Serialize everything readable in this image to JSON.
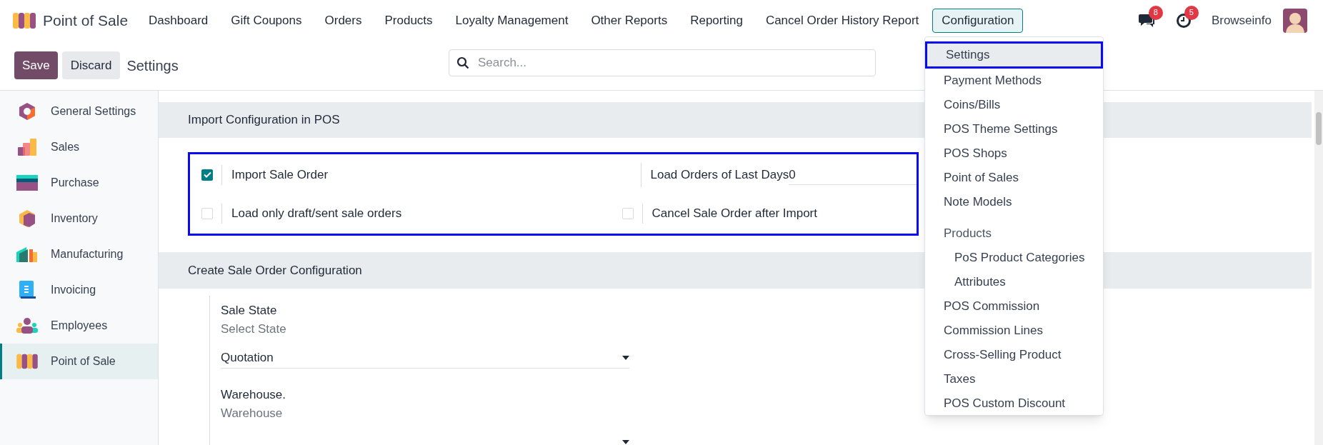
{
  "app": {
    "name": "Point of Sale"
  },
  "nav": [
    {
      "label": "Dashboard",
      "selected": false
    },
    {
      "label": "Gift Coupons",
      "selected": false
    },
    {
      "label": "Orders",
      "selected": false
    },
    {
      "label": "Products",
      "selected": false
    },
    {
      "label": "Loyalty Management",
      "selected": false
    },
    {
      "label": "Other Reports",
      "selected": false
    },
    {
      "label": "Reporting",
      "selected": false
    },
    {
      "label": "Cancel Order History Report",
      "selected": false
    },
    {
      "label": "Configuration",
      "selected": true
    }
  ],
  "systray": {
    "messages_count": "8",
    "activities_count": "5",
    "user": "Browseinfo"
  },
  "control_bar": {
    "buttons": [
      {
        "label": "Save",
        "kind": "primary"
      },
      {
        "label": "Discard",
        "kind": "secondary"
      }
    ],
    "title": "Settings",
    "search": {
      "placeholder": "Search..."
    }
  },
  "sidebar": {
    "items": [
      {
        "label": "General Settings",
        "selected": false
      },
      {
        "label": "Sales",
        "selected": false
      },
      {
        "label": "Purchase",
        "selected": false
      },
      {
        "label": "Inventory",
        "selected": false
      },
      {
        "label": "Manufacturing",
        "selected": false
      },
      {
        "label": "Invoicing",
        "selected": false
      },
      {
        "label": "Employees",
        "selected": false
      },
      {
        "label": "Point of Sale",
        "selected": true
      }
    ]
  },
  "import_section": {
    "title": "Import Configuration in POS",
    "highlighted": true,
    "settings": [
      {
        "kind": "checkbox",
        "label": "Import Sale Order",
        "checked": true
      },
      {
        "kind": "number",
        "label": "Load Orders of Last Days",
        "value": "0"
      },
      {
        "kind": "checkbox",
        "label": "Load only draft/sent sale orders",
        "checked": false
      },
      {
        "kind": "checkbox",
        "label": "Cancel Sale Order after Import",
        "checked": false
      }
    ]
  },
  "create_section": {
    "title": "Create Sale Order Configuration",
    "fields": [
      {
        "label": "Sale State",
        "help": "Select State",
        "value": "Quotation"
      },
      {
        "label": "Warehouse.",
        "help": "Warehouse"
      }
    ]
  },
  "dropdown": {
    "items": [
      {
        "label": "Settings",
        "selected": true,
        "highlighted": true
      },
      {
        "label": "Payment Methods",
        "selected": false,
        "highlighted": false
      },
      {
        "label": "Coins/Bills",
        "selected": false,
        "highlighted": false
      },
      {
        "label": "POS Theme Settings",
        "selected": false,
        "highlighted": false
      },
      {
        "label": "POS Shops",
        "selected": false,
        "highlighted": false
      },
      {
        "label": "Point of Sales",
        "selected": false,
        "highlighted": false
      },
      {
        "label": "Note Models",
        "selected": false,
        "highlighted": false
      },
      {
        "label": "Products",
        "kind": "header",
        "children": [
          {
            "label": "PoS Product Categories",
            "selected": false,
            "highlighted": false
          },
          {
            "label": "Attributes",
            "selected": false,
            "highlighted": false
          }
        ]
      },
      {
        "label": "POS Commission",
        "selected": false,
        "highlighted": false
      },
      {
        "label": "Commission Lines",
        "selected": false,
        "highlighted": false
      },
      {
        "label": "Cross-Selling Product",
        "selected": false,
        "highlighted": false
      },
      {
        "label": "Taxes",
        "selected": false,
        "highlighted": false
      },
      {
        "label": "POS Custom Discount",
        "selected": false,
        "highlighted": false
      }
    ]
  }
}
